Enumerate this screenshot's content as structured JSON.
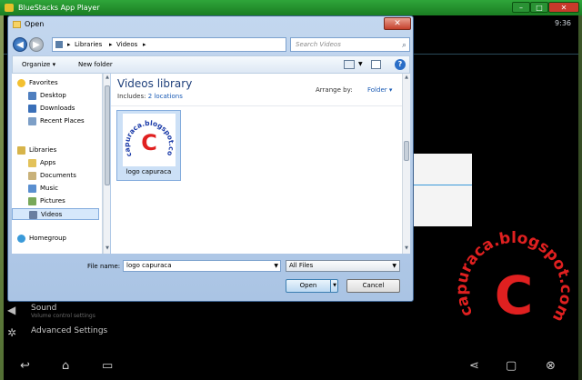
{
  "bluestacks": {
    "title": "BlueStacks App Player",
    "clock": "9:36",
    "settings": [
      {
        "title": "Sound",
        "subtitle": "Volume control settings"
      },
      {
        "title": "Advanced Settings",
        "subtitle": ""
      }
    ]
  },
  "dialog": {
    "title": "Open",
    "close_glyph": "✕",
    "breadcrumb": [
      "Libraries",
      "Videos"
    ],
    "search_placeholder": "Search Videos",
    "toolbar": {
      "organize": "Organize ▾",
      "new_folder": "New folder",
      "help": "?"
    },
    "nav_tree": [
      {
        "label": "Favorites",
        "icon": "star-icon",
        "indent": 0
      },
      {
        "label": "Desktop",
        "icon": "desktop-icon",
        "indent": 1
      },
      {
        "label": "Downloads",
        "icon": "downloads-icon",
        "indent": 1
      },
      {
        "label": "Recent Places",
        "icon": "recent-places-icon",
        "indent": 1
      },
      {
        "label": "Libraries",
        "icon": "libraries-icon",
        "indent": 0
      },
      {
        "label": "Apps",
        "icon": "folder-icon",
        "indent": 1
      },
      {
        "label": "Documents",
        "icon": "documents-icon",
        "indent": 1
      },
      {
        "label": "Music",
        "icon": "music-icon",
        "indent": 1
      },
      {
        "label": "Pictures",
        "icon": "pictures-icon",
        "indent": 1
      },
      {
        "label": "Videos",
        "icon": "videos-icon",
        "indent": 1,
        "selected": true
      },
      {
        "label": "Homegroup",
        "icon": "homegroup-icon",
        "indent": 0
      }
    ],
    "library": {
      "title": "Videos library",
      "includes_label": "Includes:",
      "includes_link": "2 locations",
      "arrange_label": "Arrange by:",
      "arrange_value": "Folder ▾"
    },
    "files": [
      {
        "name": "logo capuraca",
        "thumb_text": "capuraca.blogspot.com"
      }
    ],
    "filename_label": "File name:",
    "filename_value": "logo capuraca",
    "filetype_value": "All Files",
    "open_label": "Open",
    "cancel_label": "Cancel"
  },
  "watermark": {
    "text": "capuraca.blogspot.com",
    "letter": "C"
  },
  "colors": {
    "accent": "#1a5bb5",
    "bluestacks_green": "#1a7d22",
    "watermark_red": "#e02020"
  }
}
